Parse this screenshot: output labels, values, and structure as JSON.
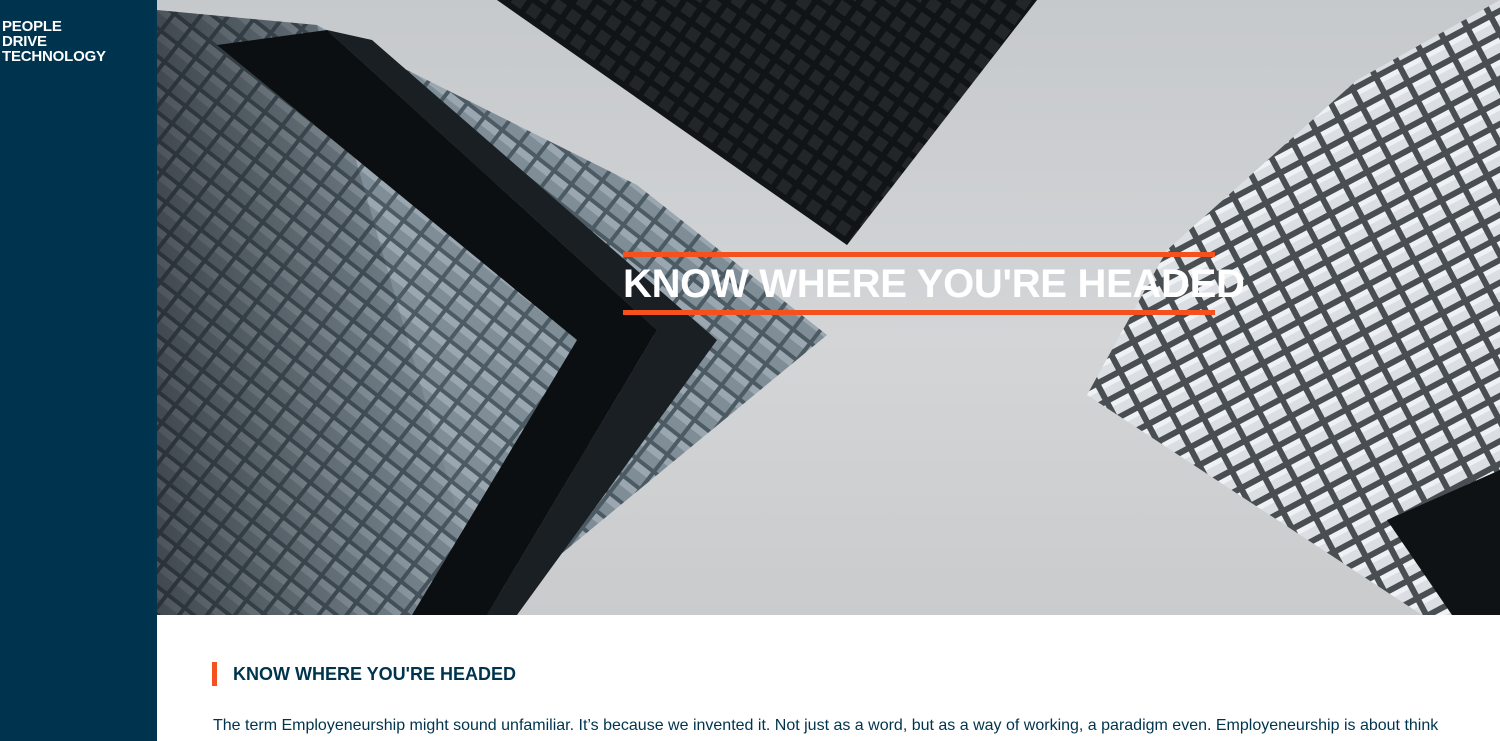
{
  "brand": {
    "logo_lines": [
      "PEOPLE",
      "DRIVE",
      "TECHNOLOGY"
    ]
  },
  "hero": {
    "title": "KNOW WHERE YOU'RE HEADED",
    "accent_color": "#f4511e"
  },
  "section": {
    "heading": "KNOW WHERE YOU'RE HEADED",
    "body": "The term Employeneurship might sound unfamiliar. It’s because we invented it. Not just as a word, but as a way of working, a paradigm even. Employeneurship is about think"
  },
  "colors": {
    "sidebar": "#00344e",
    "accent": "#f4511e",
    "text": "#00344e"
  }
}
